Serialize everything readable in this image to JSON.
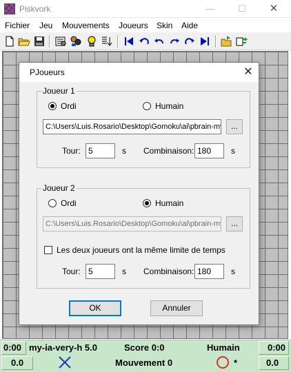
{
  "app": {
    "title": "Piskvork"
  },
  "window_controls": {
    "minimize": "—",
    "maximize": "☐",
    "close": "✕"
  },
  "menu": [
    "Fichier",
    "Jeu",
    "Mouvements",
    "Joueurs",
    "Skin",
    "Aide"
  ],
  "status": {
    "left_time": "0:00",
    "ai_name": "my-ia-very-h 5.0",
    "score": "Score 0:0",
    "right_player": "Humain",
    "right_time": "0:00",
    "left_value": "0.0",
    "move": "Mouvement 0",
    "star": "*",
    "right_value": "0.0",
    "colors": {
      "cross": "#2233cc",
      "circle": "#e03030",
      "background": "#c8e6c9"
    }
  },
  "dialog": {
    "title": "PJoueurs",
    "close": "✕",
    "player1": {
      "group_label": "Joueur 1",
      "option_computer": "Ordi",
      "option_human": "Humain",
      "selected": "computer",
      "path": "C:\\Users\\Luis.Rosario\\Desktop\\Gomoku\\ai\\pbrain-my",
      "browse": "...",
      "turn_label": "Tour:",
      "turn_value": "5",
      "turn_unit": "s",
      "combo_label": "Combinaison:",
      "combo_value": "180",
      "combo_unit": "s"
    },
    "player2": {
      "group_label": "Joueur 2",
      "option_computer": "Ordi",
      "option_human": "Humain",
      "selected": "human",
      "path": "C:\\Users\\Luis.Rosario\\Desktop\\Gomoku\\ai\\pbrain-my",
      "browse": "...",
      "same_time_label": "Les deux joueurs ont la même limite de temps",
      "same_time_checked": false,
      "turn_label": "Tour:",
      "turn_value": "5",
      "turn_unit": "s",
      "combo_label": "Combinaison:",
      "combo_value": "180",
      "combo_unit": "s"
    },
    "ok": "OK",
    "cancel": "Annuler"
  }
}
